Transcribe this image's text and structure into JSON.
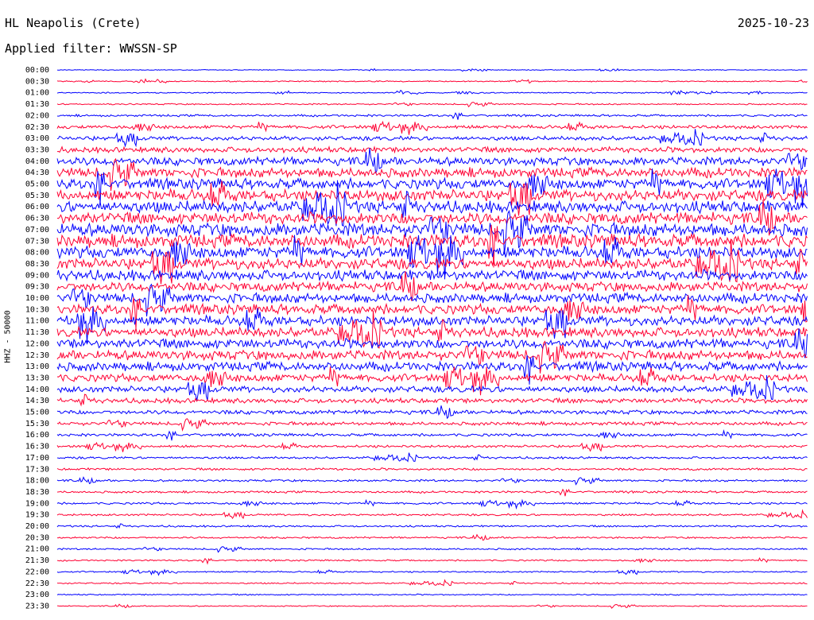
{
  "header": {
    "station": "HL Neapolis (Crete)",
    "date": "2025-10-23",
    "filter": "Applied filter: WWSSN-SP"
  },
  "colors": {
    "trace_a": "#0000ff",
    "trace_b": "#ff0033"
  },
  "chart_data": {
    "type": "line",
    "title": "HL Neapolis (Crete)",
    "ylabel": "HHZ - 50000",
    "xlabel": "",
    "row_interval_minutes": 30,
    "row_labels": [
      "00:00",
      "00:30",
      "01:00",
      "01:30",
      "02:00",
      "02:30",
      "03:00",
      "03:30",
      "04:00",
      "04:30",
      "05:00",
      "05:30",
      "06:00",
      "06:30",
      "07:00",
      "07:30",
      "08:00",
      "08:30",
      "09:00",
      "09:30",
      "10:00",
      "10:30",
      "11:00",
      "11:30",
      "12:00",
      "12:30",
      "13:00",
      "13:30",
      "14:00",
      "14:30",
      "15:00",
      "15:30",
      "16:00",
      "16:30",
      "17:00",
      "17:30",
      "18:00",
      "18:30",
      "19:00",
      "19:30",
      "20:00",
      "20:30",
      "21:00",
      "21:30",
      "22:00",
      "22:30",
      "23:00",
      "23:30"
    ],
    "row_noise_level": [
      0.6,
      0.8,
      0.8,
      1.0,
      1.5,
      2.5,
      3.0,
      4.0,
      6.0,
      7.0,
      7.5,
      8.0,
      8.5,
      8.5,
      9.5,
      9.5,
      8.5,
      8.0,
      7.5,
      7.0,
      7.0,
      7.0,
      7.0,
      7.0,
      7.0,
      7.0,
      6.5,
      5.5,
      4.5,
      3.5,
      3.0,
      2.5,
      2.0,
      1.8,
      1.6,
      1.6,
      1.5,
      1.5,
      1.5,
      1.4,
      1.3,
      1.3,
      1.2,
      1.1,
      1.0,
      1.0,
      0.9,
      0.8
    ],
    "grid": false
  }
}
